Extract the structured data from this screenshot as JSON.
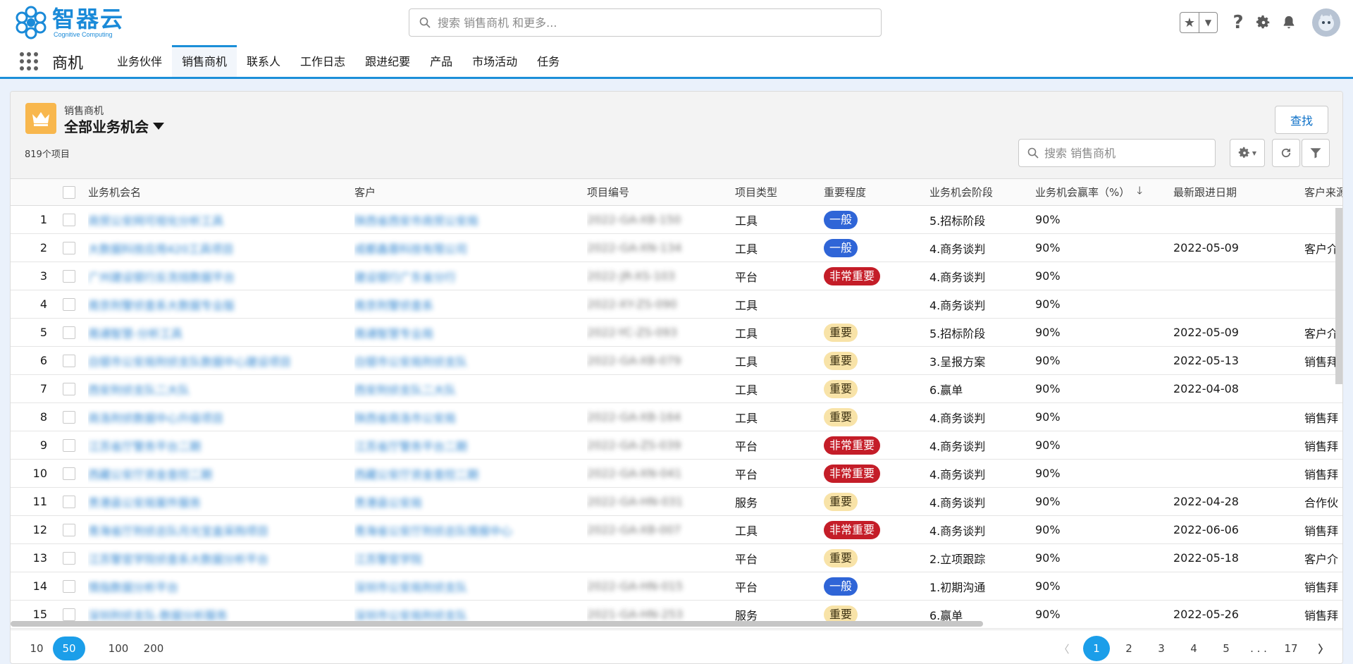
{
  "brand": {
    "name_cn": "智器云",
    "name_en": "Cognitive Computing",
    "color": "#1a8ad8"
  },
  "search": {
    "placeholder": "搜索 销售商机 和更多..."
  },
  "app": {
    "name": "商机"
  },
  "nav": {
    "tabs": [
      {
        "label": "业务伙伴",
        "active": false
      },
      {
        "label": "销售商机",
        "active": true
      },
      {
        "label": "联系人",
        "active": false
      },
      {
        "label": "工作日志",
        "active": false
      },
      {
        "label": "跟进纪要",
        "active": false
      },
      {
        "label": "产品",
        "active": false
      },
      {
        "label": "市场活动",
        "active": false
      },
      {
        "label": "任务",
        "active": false
      }
    ]
  },
  "list": {
    "object_label": "销售商机",
    "view_name": "全部业务机会",
    "count": "819个项目",
    "find_button": "查找",
    "search_placeholder": "搜索 销售商机",
    "columns": [
      "业务机会名",
      "客户",
      "项目编号",
      "项目类型",
      "重要程度",
      "业务机会阶段",
      "业务机会赢率（%）",
      "最新跟进日期",
      "客户来源"
    ],
    "rows": [
      {
        "n": "1",
        "name": "商贸公安网可视化分析工具",
        "cust": "陕西省西安市商贸公安局",
        "code": "2022-GA-XB-150",
        "type": "工具",
        "imp": "一般",
        "imp_kind": "normal",
        "stage": "5.招标阶段",
        "rate": "90%",
        "date": "",
        "src": ""
      },
      {
        "n": "2",
        "name": "大数据科技应用420工具项目",
        "cust": "成都鑫蓉科技有限公司",
        "code": "2022-GA-XN-134",
        "type": "工具",
        "imp": "一般",
        "imp_kind": "normal",
        "stage": "4.商务谈判",
        "rate": "90%",
        "date": "2022-05-09",
        "src": "客户介"
      },
      {
        "n": "3",
        "name": "广州建设银行反洗钱数据平台",
        "cust": "建设银行广东省分行",
        "code": "2022-JR-XS-103",
        "type": "平台",
        "imp": "非常重要",
        "imp_kind": "crit",
        "stage": "4.商务谈判",
        "rate": "90%",
        "date": "",
        "src": ""
      },
      {
        "n": "4",
        "name": "南京刑警侦查系大数据专业版",
        "cust": "南京刑警侦查系",
        "code": "2022-XY-ZS-090",
        "type": "工具",
        "imp": "",
        "imp_kind": "",
        "stage": "4.商务谈判",
        "rate": "90%",
        "date": "",
        "src": ""
      },
      {
        "n": "5",
        "name": "南通智慧-分析工具",
        "cust": "南通智慧专业局",
        "code": "2022-YC-ZS-093",
        "type": "工具",
        "imp": "重要",
        "imp_kind": "high",
        "stage": "5.招标阶段",
        "rate": "90%",
        "date": "2022-05-09",
        "src": "客户介"
      },
      {
        "n": "6",
        "name": "白银市公安局刑侦支队数据中心建设项目",
        "cust": "白银市公安局刑侦支队",
        "code": "2022-GA-XB-079",
        "type": "工具",
        "imp": "重要",
        "imp_kind": "high",
        "stage": "3.呈报方案",
        "rate": "90%",
        "date": "2022-05-13",
        "src": "销售拜"
      },
      {
        "n": "7",
        "name": "西安刑侦支队二大队",
        "cust": "西安刑侦支队二大队",
        "code": "",
        "type": "工具",
        "imp": "重要",
        "imp_kind": "high",
        "stage": "6.赢单",
        "rate": "90%",
        "date": "2022-04-08",
        "src": ""
      },
      {
        "n": "8",
        "name": "商洛刑侦数据中心升级项目",
        "cust": "陕西省商洛市公安局",
        "code": "2022-GA-XB-164",
        "type": "工具",
        "imp": "重要",
        "imp_kind": "high",
        "stage": "4.商务谈判",
        "rate": "90%",
        "date": "",
        "src": "销售拜"
      },
      {
        "n": "9",
        "name": "江苏省厅警务平台二期",
        "cust": "江苏省厅警务平台二期",
        "code": "2022-GA-ZS-039",
        "type": "平台",
        "imp": "非常重要",
        "imp_kind": "crit",
        "stage": "4.商务谈判",
        "rate": "90%",
        "date": "",
        "src": "销售拜"
      },
      {
        "n": "10",
        "name": "西藏公安厅资金查控二期",
        "cust": "西藏公安厅资金查控二期",
        "code": "2022-GA-XN-041",
        "type": "平台",
        "imp": "非常重要",
        "imp_kind": "crit",
        "stage": "4.商务谈判",
        "rate": "90%",
        "date": "",
        "src": "销售拜"
      },
      {
        "n": "11",
        "name": "贵港县公安局案件服务",
        "cust": "贵港县公安局",
        "code": "2022-GA-HN-031",
        "type": "服务",
        "imp": "重要",
        "imp_kind": "high",
        "stage": "4.商务谈判",
        "rate": "90%",
        "date": "2022-04-28",
        "src": "合作伙"
      },
      {
        "n": "12",
        "name": "青海省厅刑侦总队月光宝盒采购项目",
        "cust": "青海省公安厅刑侦总队情报中心",
        "code": "2022-GA-XB-007",
        "type": "工具",
        "imp": "非常重要",
        "imp_kind": "crit",
        "stage": "4.商务谈判",
        "rate": "90%",
        "date": "2022-06-06",
        "src": "销售拜"
      },
      {
        "n": "13",
        "name": "江苏警官学院侦查系大数据分析平台",
        "cust": "江苏警官学院",
        "code": "",
        "type": "平台",
        "imp": "重要",
        "imp_kind": "high",
        "stage": "2.立项跟踪",
        "rate": "90%",
        "date": "2022-05-18",
        "src": "客户介"
      },
      {
        "n": "14",
        "name": "情指数据分析平台",
        "cust": "深圳市公安局刑侦支队",
        "code": "2022-GA-HN-015",
        "type": "平台",
        "imp": "一般",
        "imp_kind": "normal",
        "stage": "1.初期沟通",
        "rate": "90%",
        "date": "",
        "src": "销售拜"
      },
      {
        "n": "15",
        "name": "深圳刑侦支队-数据分析服务",
        "cust": "深圳市公安局刑侦支队",
        "code": "2021-GA-HN-253",
        "type": "服务",
        "imp": "重要",
        "imp_kind": "high",
        "stage": "6.赢单",
        "rate": "90%",
        "date": "2022-05-26",
        "src": "销售拜"
      }
    ]
  },
  "footer": {
    "page_sizes": [
      {
        "label": "10"
      },
      {
        "label": "50",
        "active": true
      },
      {
        "label": "100"
      },
      {
        "label": "200"
      }
    ],
    "pages": [
      "1",
      "2",
      "3",
      "4",
      "5",
      ". . .",
      "17"
    ],
    "current_page": "1"
  },
  "colors": {
    "accent": "#1b8fd8",
    "badge_normal": "#2f65d7",
    "badge_high": "#f8e3a8",
    "badge_critical": "#c41d28"
  },
  "icons": [
    "search-icon",
    "star-icon",
    "chevron-down-icon",
    "help-icon",
    "gear-icon",
    "bell-icon",
    "app-launcher-icon",
    "crown-icon",
    "refresh-icon",
    "filter-icon",
    "sort-desc-icon",
    "chevron-left-icon",
    "chevron-right-icon"
  ]
}
